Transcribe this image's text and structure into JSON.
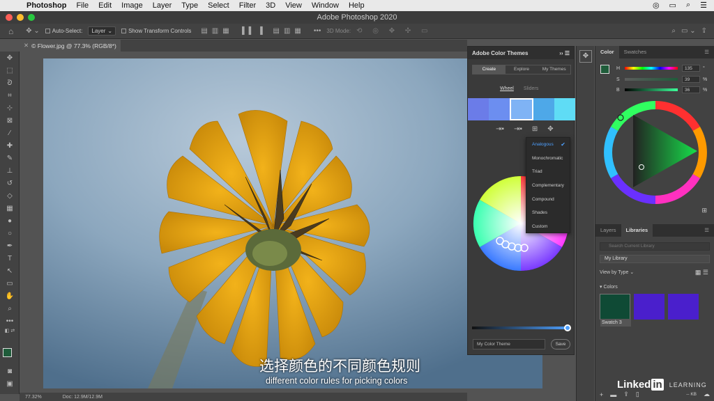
{
  "menubar": {
    "app": "Photoshop",
    "items": [
      "File",
      "Edit",
      "Image",
      "Layer",
      "Type",
      "Select",
      "Filter",
      "3D",
      "View",
      "Window",
      "Help"
    ]
  },
  "window": {
    "title": "Adobe Photoshop 2020"
  },
  "options": {
    "auto_select": "Auto-Select:",
    "layer_select": "Layer",
    "show_transform": "Show Transform Controls",
    "mode_3d": "3D Mode:"
  },
  "document": {
    "tab_title": "© Flower.jpg @ 77.3% (RGB/8*)",
    "zoom": "77.32%",
    "doc_info": "Doc: 12.9M/12.9M"
  },
  "color_themes": {
    "title": "Adobe Color Themes",
    "modes": [
      "Create",
      "Explore",
      "My Themes"
    ],
    "active_mode": "Create",
    "subtabs": [
      "Wheel",
      "Sliders"
    ],
    "active_subtab": "Wheel",
    "theme_colors": [
      "#6b7ce8",
      "#6c8ef0",
      "#7fb3f5",
      "#4ea8e8",
      "#5fdcf5"
    ],
    "rules": [
      "Analogous",
      "Monochromatic",
      "Triad",
      "Complementary",
      "Compound",
      "Shades",
      "Custom"
    ],
    "selected_rule": "Analogous",
    "theme_name_placeholder": "My Color Theme",
    "save_label": "Save"
  },
  "color_panel": {
    "tabs": [
      "Color",
      "Swatches"
    ],
    "active_tab": "Color",
    "h": {
      "label": "H",
      "value": "135",
      "unit": "°"
    },
    "s": {
      "label": "S",
      "value": "39",
      "unit": "%"
    },
    "b": {
      "label": "B",
      "value": "36",
      "unit": "%"
    },
    "foreground": "#1f5c3a"
  },
  "libraries_panel": {
    "tabs": [
      "Layers",
      "Libraries"
    ],
    "active_tab": "Libraries",
    "search_placeholder": "Search Current Library",
    "library": "My Library",
    "view_by": "View by Type",
    "section": "Colors",
    "swatches": [
      {
        "label": "Swatch 3",
        "color": "#0f4a35"
      },
      {
        "color": "#4a1fcc"
      },
      {
        "color": "#4a1fcc"
      }
    ],
    "footer_size": "-- KB"
  },
  "subtitle": {
    "zh": "选择颜色的不同颜色规则",
    "en": "different color rules for picking colors"
  },
  "watermark": {
    "brand": "Linked",
    "in": "in",
    "learning": "LEARNING"
  }
}
